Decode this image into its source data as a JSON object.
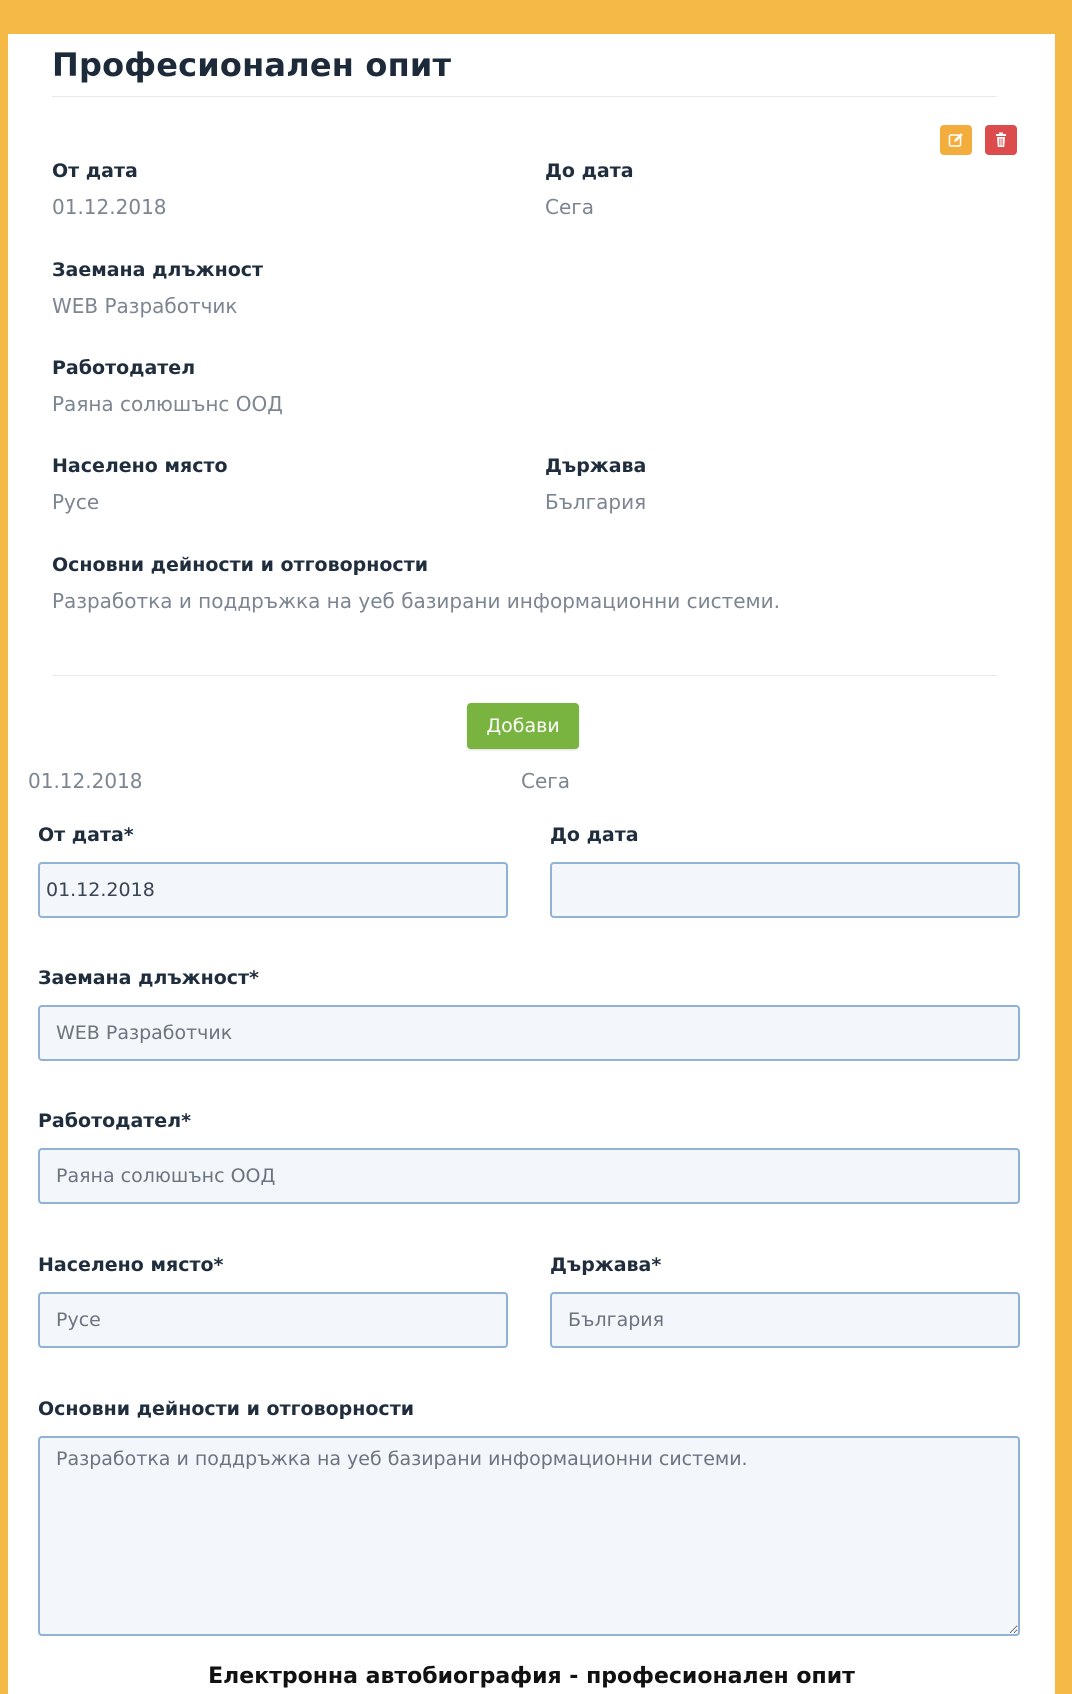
{
  "section": {
    "title": "Професионален опит"
  },
  "record": {
    "from_label": "От дата",
    "from_value": "01.12.2018",
    "to_label": "До дата",
    "to_value": "Сега",
    "position_label": "Заемана длъжност",
    "position_value": "WEB Разработчик",
    "employer_label": "Работодател",
    "employer_value": "Раяна солюшънс ООД",
    "city_label": "Населено място",
    "city_value": "Русе",
    "country_label": "Държава",
    "country_value": "България",
    "duties_label": "Основни дейности и отговорности",
    "duties_value": "Разработка и поддръжка на уеб базирани информационни системи."
  },
  "actions": {
    "edit_icon": "edit-icon",
    "delete_icon": "trash-icon",
    "edit_color": "#f3ad3d",
    "delete_color": "#dc4c4c"
  },
  "add_button": {
    "label": "Добави",
    "color": "#78b43f"
  },
  "preview": {
    "from": "01.12.2018",
    "to": "Сега"
  },
  "form": {
    "from_label": "От дата*",
    "from_value": "01.12.2018",
    "to_label": "До дата",
    "to_value": "",
    "position_label": "Заемана длъжност*",
    "position_value": "WEB Разработчик",
    "employer_label": "Работодател*",
    "employer_value": "Раяна солюшънс ООД",
    "city_label": "Населено място*",
    "city_value": "Русе",
    "country_label": "Държава*",
    "country_value": "България",
    "duties_label": "Основни дейности и отговорности",
    "duties_value": "Разработка и поддръжка на уеб базирани информационни системи."
  },
  "caption": "Електронна автобиография - професионален опит",
  "colors": {
    "frame": "#f5b945",
    "input_border": "#8fb2d6"
  }
}
